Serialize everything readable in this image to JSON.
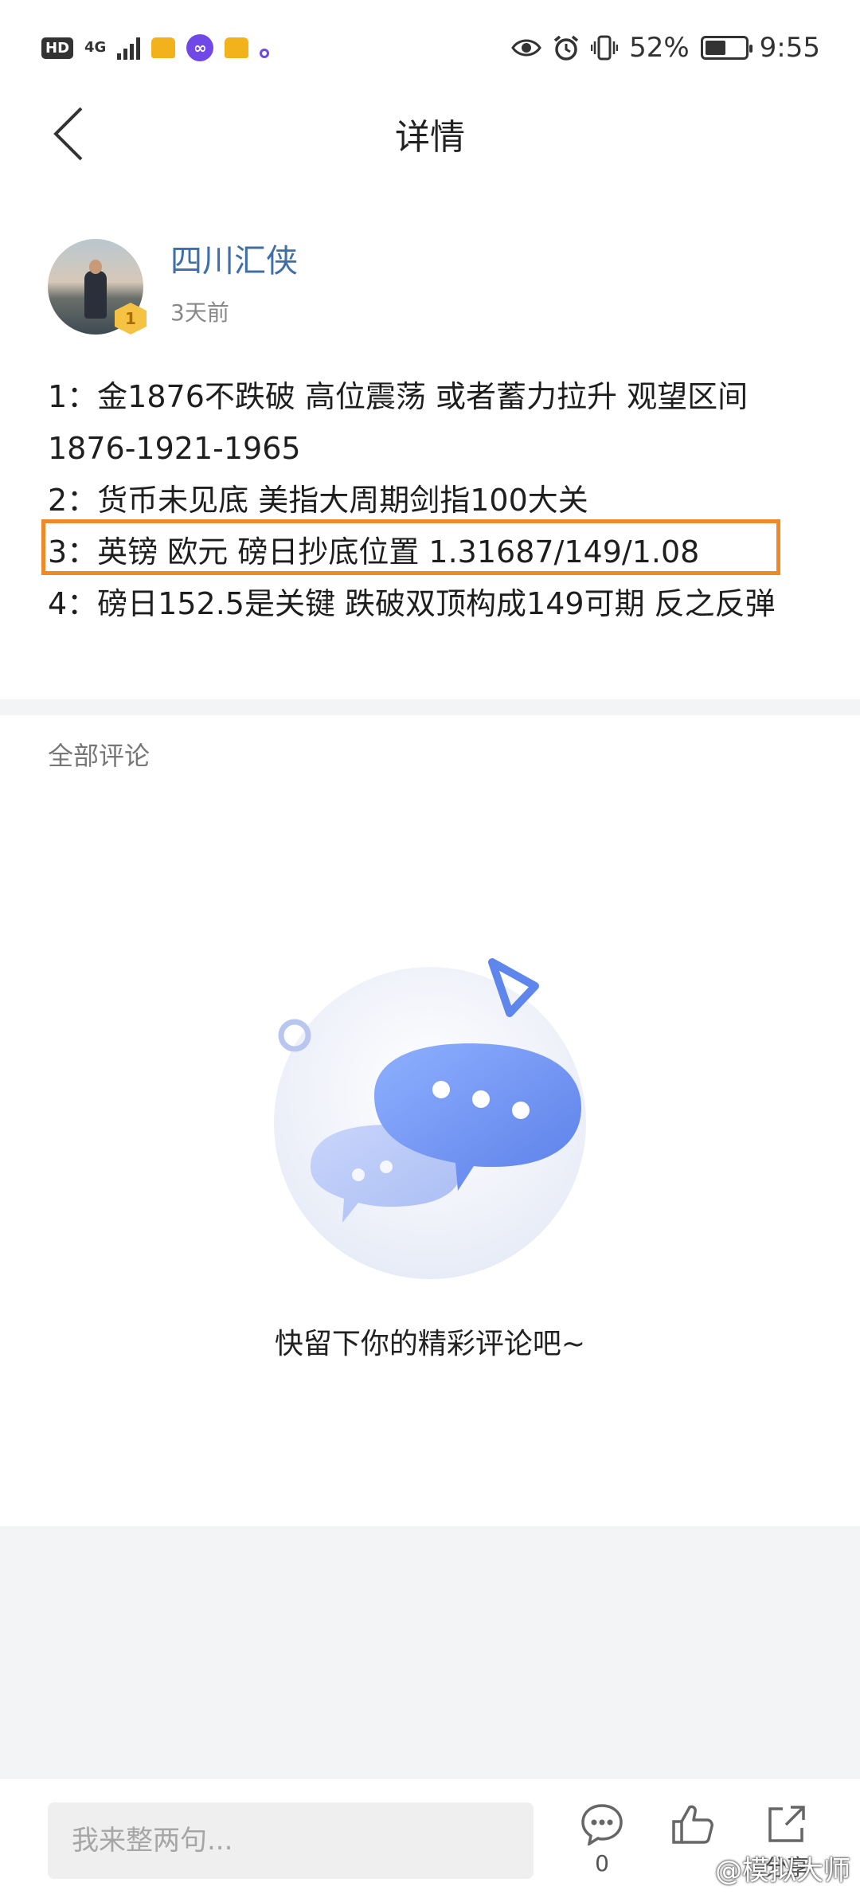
{
  "status_bar": {
    "hd": "HD",
    "network": "4G",
    "battery_percent": "52%",
    "battery_level": 0.52,
    "time": "9:55",
    "icons": [
      "eye-icon",
      "alarm-icon",
      "vibrate-icon",
      "battery-icon"
    ]
  },
  "header": {
    "title": "详情"
  },
  "post": {
    "author_name": "四川汇侠",
    "level": "1",
    "time": "3天前",
    "lines": [
      "1：金1876不跌破 高位震荡 或者蓄力拉升 观望区间",
      "1876-1921-1965",
      "2：货币未见底 美指大周期剑指100大关",
      "3：英镑 欧元 磅日抄底位置 1.31687/149/1.08",
      "4：磅日152.5是关键 跌破双顶构成149可期 反之反弹"
    ],
    "highlight_color": "#ef8a2a"
  },
  "comments": {
    "header": "全部评论",
    "empty_text": "快留下你的精彩评论吧~"
  },
  "bottom_bar": {
    "input_placeholder": "我来整两句...",
    "comment_count": "0",
    "share_label": "分享"
  },
  "watermark": "@模拟大师"
}
